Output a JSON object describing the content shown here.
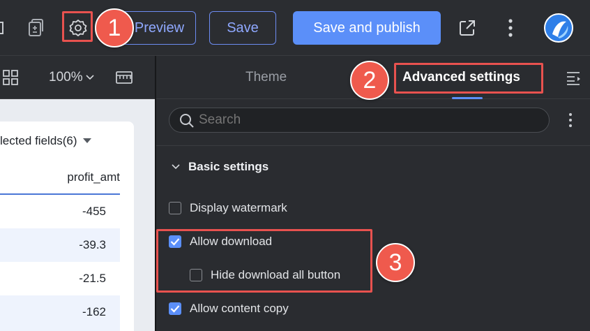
{
  "topbar": {
    "preview_label": "Preview",
    "save_label": "Save",
    "publish_label": "Save and publish"
  },
  "left": {
    "zoom": "100%",
    "selected_fields": "lected fields(6)",
    "column_header": "profit_amt",
    "values": [
      "-455",
      "-39.3",
      "-21.5",
      "-162"
    ]
  },
  "panel": {
    "tabs": [
      "Theme",
      "Advanced settings"
    ],
    "search_placeholder": "Search",
    "section_title": "Basic settings",
    "options": {
      "watermark": "Display watermark",
      "allow_download": "Allow download",
      "hide_download_all": "Hide download all button",
      "allow_copy": "Allow content copy"
    }
  },
  "callouts": [
    "1",
    "2",
    "3"
  ],
  "colors": {
    "accent": "#5b8ff9",
    "callout": "#ef5a4d"
  }
}
